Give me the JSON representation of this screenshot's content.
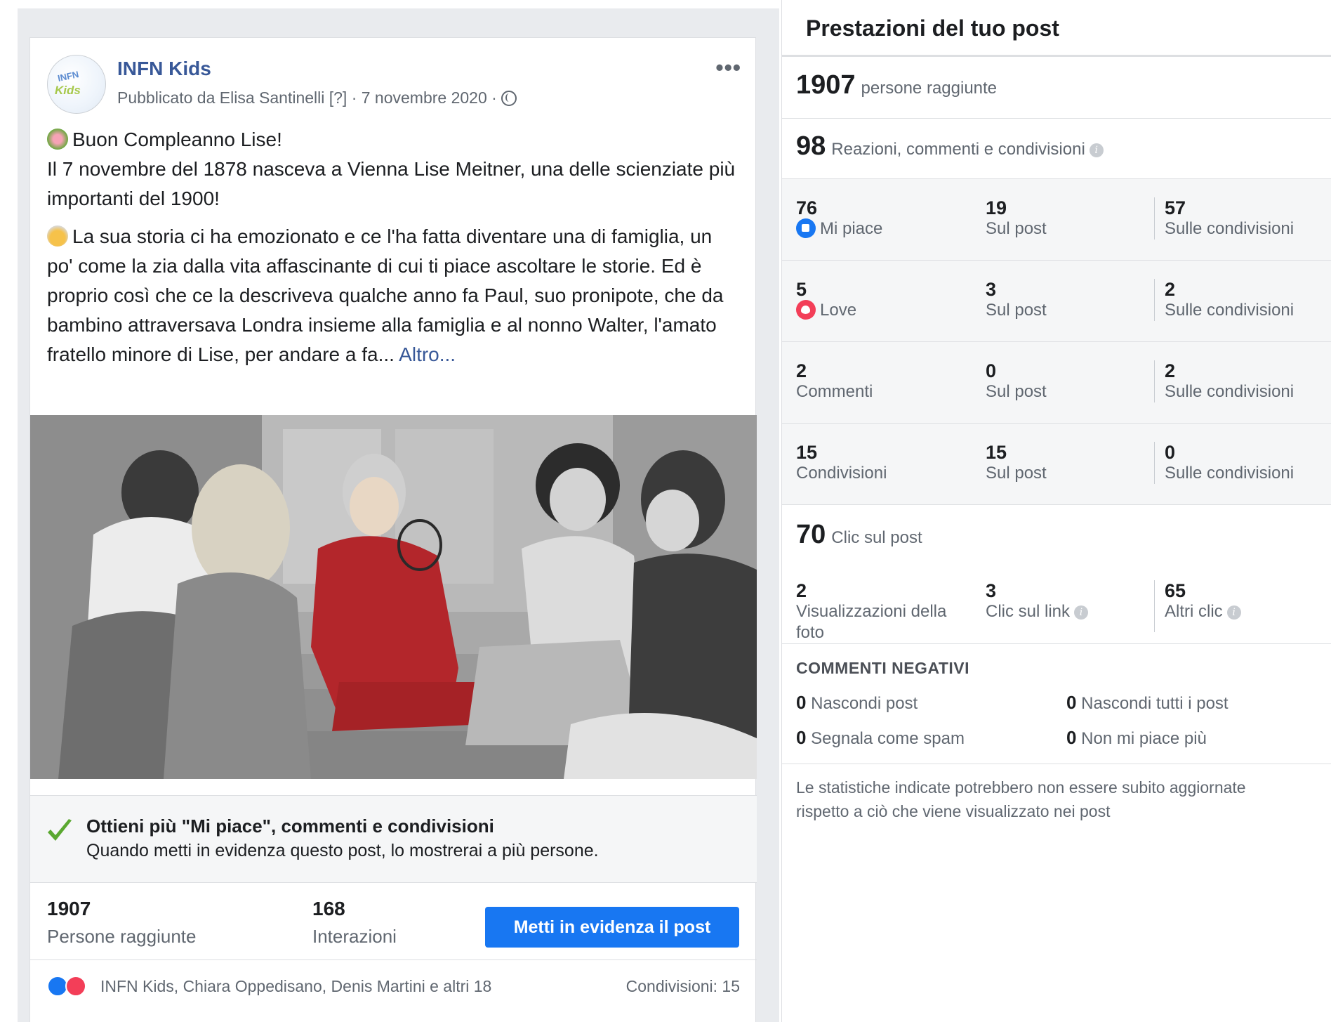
{
  "post": {
    "page_name": "INFN Kids",
    "avatar_text_top": "INFN",
    "avatar_text_bottom": "Kids",
    "meta": "Pubblicato da Elisa Santinelli [?] · 7 novembre 2020 · ",
    "more_label": "•••",
    "paragraph1_line1": "Buon Compleanno Lise!",
    "paragraph1_rest": "Il 7 novembre del 1878 nasceva a Vienna Lise Meitner, una delle scienziate più importanti del 1900!",
    "paragraph2": "La sua storia ci ha emozionato e ce l'ha fatta diventare una di famiglia, un po' come la zia dalla vita affascinante di cui ti piace ascoltare le storie. Ed è proprio così che ce la descriveva qualche anno fa Paul, suo pronipote, che da bambino attraversava Londra insieme alla famiglia e al nonno Walter, l'amato fratello minore di Lise, per andare a fa...",
    "see_more": "Altro...",
    "boost_title": "Ottieni più \"Mi piace\", commenti e condivisioni",
    "boost_sub": "Quando metti in evidenza questo post, lo mostrerai a più persone.",
    "reach_value": "1907",
    "reach_label": "Persone raggiunte",
    "interactions_value": "168",
    "interactions_label": "Interazioni",
    "boost_button": "Metti in evidenza il post",
    "reactors": "INFN Kids, Chiara Oppedisano, Denis Martini e altri 18",
    "shares": "Condivisioni: 15"
  },
  "panel": {
    "title": "Prestazioni del tuo post",
    "reach": {
      "value": "1907",
      "label": "persone raggiunte"
    },
    "engagement": {
      "value": "98",
      "label": "Reazioni, commenti e condivisioni"
    },
    "rows": [
      {
        "total": "76",
        "label": "Mi piace",
        "on_post": "19",
        "on_post_label": "Sul post",
        "on_shares": "57",
        "on_shares_label": "Sulle condivisioni"
      },
      {
        "total": "5",
        "label": "Love",
        "on_post": "3",
        "on_post_label": "Sul post",
        "on_shares": "2",
        "on_shares_label": "Sulle condivisioni"
      },
      {
        "total": "2",
        "label": "Commenti",
        "on_post": "0",
        "on_post_label": "Sul post",
        "on_shares": "2",
        "on_shares_label": "Sulle condivisioni"
      },
      {
        "total": "15",
        "label": "Condivisioni",
        "on_post": "15",
        "on_post_label": "Sul post",
        "on_shares": "0",
        "on_shares_label": "Sulle condivisioni"
      }
    ],
    "clicks": {
      "value": "70",
      "label": "Clic sul post"
    },
    "click_breakdown": [
      {
        "value": "2",
        "label_line1": "Visualizzazioni della",
        "label_line2": "foto"
      },
      {
        "value": "3",
        "label": "Clic sul link"
      },
      {
        "value": "65",
        "label": "Altri clic"
      }
    ],
    "negative_title": "COMMENTI NEGATIVI",
    "negative": [
      {
        "value": "0",
        "label": "Nascondi post"
      },
      {
        "value": "0",
        "label": "Nascondi tutti i post"
      },
      {
        "value": "0",
        "label": "Segnala come spam"
      },
      {
        "value": "0",
        "label": "Non mi piace più"
      }
    ],
    "footnote": "Le statistiche indicate potrebbero non essere subito aggiornate rispetto a ciò che viene visualizzato nei post",
    "info_glyph": "i"
  },
  "colors": {
    "link": "#385898",
    "button": "#1877f2",
    "like": "#1877f2",
    "love": "#f33e58",
    "check": "#5aa830"
  }
}
